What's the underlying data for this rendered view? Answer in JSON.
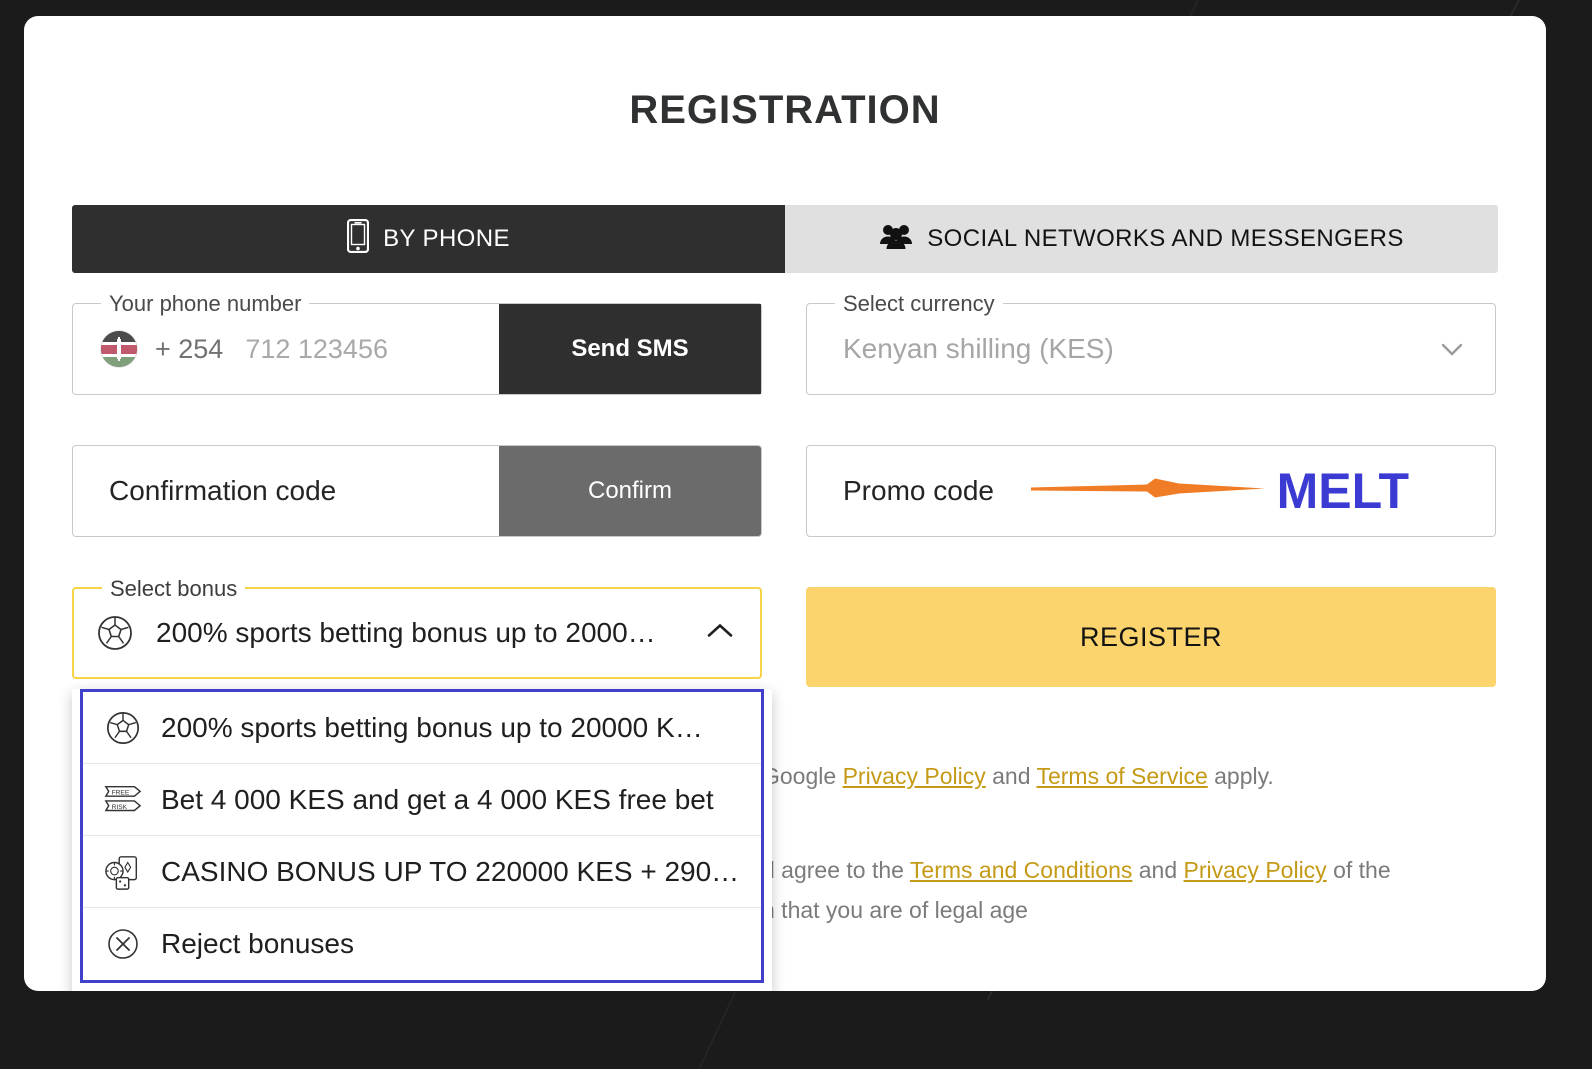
{
  "page": {
    "title": "REGISTRATION"
  },
  "tabs": [
    {
      "id": "by-phone",
      "label": "BY PHONE",
      "icon": "mobile-phone-icon",
      "active": true
    },
    {
      "id": "social",
      "label": "SOCIAL NETWORKS AND MESSENGERS",
      "icon": "people-group-icon",
      "active": false
    }
  ],
  "phone": {
    "legend": "Your phone number",
    "flag_icon": "kenya-flag-icon",
    "dial_code": "+ 254",
    "placeholder": "712 123456",
    "value": "",
    "send_sms_label": "Send SMS"
  },
  "currency": {
    "legend": "Select currency",
    "value": "Kenyan shilling (KES)",
    "chevron_icon": "chevron-down-icon"
  },
  "confirmation": {
    "placeholder": "Confirmation code",
    "value": "",
    "confirm_label": "Confirm"
  },
  "promo": {
    "placeholder": "Promo code",
    "value": "",
    "annotation_text": "MELT",
    "annotation_color": "#3b3bd4",
    "arrow_color": "#f07c26",
    "arrow_icon": "arrow-right-annotation"
  },
  "bonus": {
    "legend": "Select bonus",
    "selected_icon": "soccer-ball-icon",
    "selected_label": "200% sports betting bonus up to 2000…",
    "caret_icon": "chevron-up-icon",
    "open": true,
    "options": [
      {
        "icon": "soccer-ball-icon",
        "label": "200% sports betting bonus up to 20000 K…"
      },
      {
        "icon": "free-risk-ticket-icon",
        "label": "Bet 4 000 KES and get a 4 000 KES free bet"
      },
      {
        "icon": "casino-chip-cards-icon",
        "label": "CASINO BONUS UP TO 220000 KES + 290…"
      },
      {
        "icon": "circle-x-icon",
        "label": "Reject bonuses"
      }
    ]
  },
  "register": {
    "label": "REGISTER",
    "color": "#fbd46d"
  },
  "legal": {
    "recaptcha_prefix": "Google ",
    "recaptcha_link1": "Privacy Policy",
    "recaptcha_mid": " and ",
    "recaptcha_link2": "Terms of Service",
    "recaptcha_suffix": " apply.",
    "terms_prefix": "d agree to the ",
    "terms_link1": "Terms and Conditions",
    "terms_mid": " and ",
    "terms_link2": "Privacy Policy",
    "terms_suffix": " of the",
    "terms_line2": "n that you are of legal age"
  }
}
